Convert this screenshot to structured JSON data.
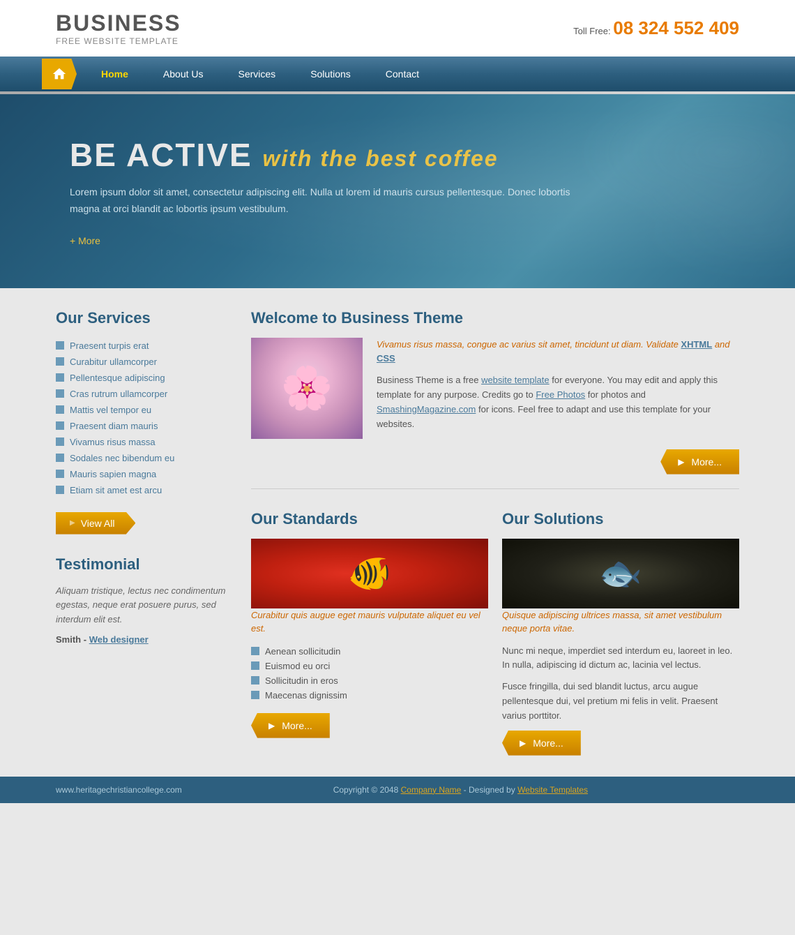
{
  "header": {
    "brand": "BUSINESS",
    "sub": "FREE WEBSITE TEMPLATE",
    "toll_free_label": "Toll Free:",
    "phone": "08 324 552 409"
  },
  "nav": {
    "home": "Home",
    "about": "About Us",
    "services": "Services",
    "solutions": "Solutions",
    "contact": "Contact"
  },
  "hero": {
    "headline_main": "BE ACTIVE",
    "headline_accent": "with the best coffee",
    "description": "Lorem ipsum dolor sit amet, consectetur adipiscing elit. Nulla ut lorem id mauris cursus pellentesque. Donec lobortis magna at orci blandit ac lobortis ipsum vestibulum.",
    "more_label": "+ More"
  },
  "sidebar": {
    "services_title": "Our Services",
    "service_items": [
      "Praesent turpis erat",
      "Curabitur ullamcorper",
      "Pellentesque adipiscing",
      "Cras rutrum ullamcorper",
      "Mattis vel tempor eu",
      "Praesent diam mauris",
      "Vivamus risus massa",
      "Sodales nec bibendum eu",
      "Mauris sapien magna",
      "Etiam sit amet est arcu"
    ],
    "view_all_label": "View All",
    "testimonial_title": "Testimonial",
    "testimonial_text": "Aliquam tristique, lectus nec condimentum egestas, neque erat posuere purus, sed interdum elit est.",
    "testimonial_author": "Smith -",
    "testimonial_role": "Web designer"
  },
  "welcome": {
    "title": "Welcome to Business Theme",
    "italic_text": "Vivamus risus massa, congue ac varius sit amet, tincidunt ut diam. Validate XHTML and CSS",
    "xhtml_label": "XHTML",
    "css_label": "CSS",
    "body": "Business Theme is a free website template for everyone. You may edit and apply this template for any purpose. Credits go to Free Photos for photos and SmashingMagazine.com for icons. Feel free to adapt and use this template for your websites.",
    "website_template_label": "website template",
    "free_photos_label": "Free Photos",
    "smashing_label": "SmashingMagazine.com",
    "more_label": "More..."
  },
  "standards": {
    "title": "Our Standards",
    "italic_text": "Curabitur quis augue eget mauris vulputate aliquet eu vel est.",
    "list_items": [
      "Aenean sollicitudin",
      "Euismod eu orci",
      "Sollicitudin in eros",
      "Maecenas dignissim"
    ],
    "more_label": "More..."
  },
  "solutions": {
    "title": "Our Solutions",
    "italic_text": "Quisque adipiscing ultrices massa, sit amet vestibulum neque porta vitae.",
    "body1": "Nunc mi neque, imperdiet sed interdum eu, laoreet in leo. In nulla, adipiscing id dictum ac, lacinia vel lectus.",
    "body2": "Fusce fringilla, dui sed blandit luctus, arcu augue pellentesque dui, vel pretium mi felis in velit. Praesent varius porttitor.",
    "more_label": "More..."
  },
  "footer": {
    "site_url": "www.heritagechristiancollege.com",
    "copyright": "Copyright © 2048",
    "company_label": "Company Name",
    "designed_by": "- Designed by",
    "website_templates_label": "Website Templates"
  }
}
